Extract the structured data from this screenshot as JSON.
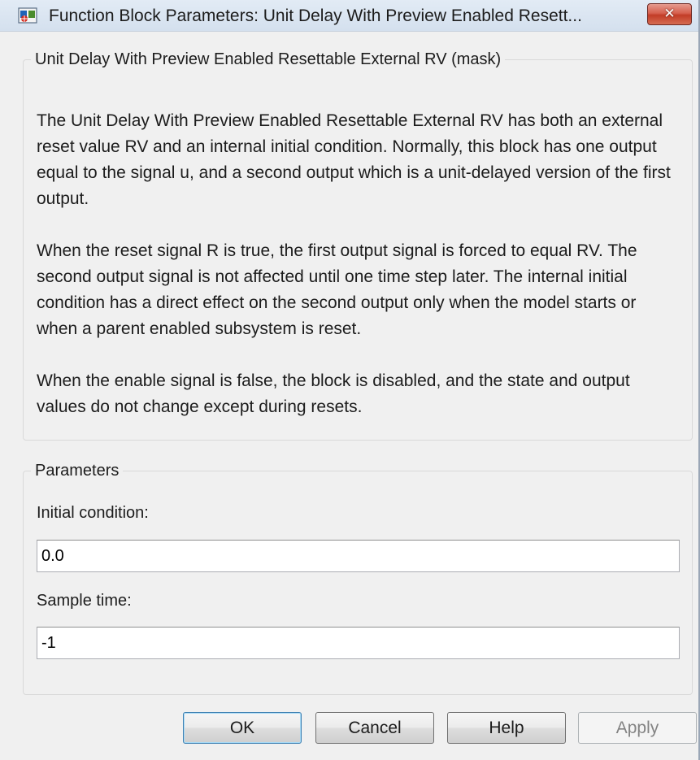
{
  "window": {
    "title": "Function Block Parameters: Unit Delay With Preview Enabled Resett...",
    "app_icon": "simulink-block-icon",
    "close_icon": "close-icon",
    "close_label": "✕"
  },
  "description": {
    "group_title": "Unit Delay With Preview Enabled Resettable External RV (mask)",
    "paragraphs": [
      "The Unit Delay With Preview Enabled Resettable External RV has both an external reset value RV and an internal initial condition. Normally, this block has one output equal to the signal u, and a second output which is a unit-delayed version of the first output.",
      "When the reset signal R is true, the first output signal is forced to equal RV. The second output signal is not affected until one time step later. The internal initial condition has a direct effect on the second output only when the model starts or when a parent enabled subsystem is reset.",
      "When the enable signal is false, the block is disabled, and the state and output values do not change except during resets."
    ]
  },
  "parameters": {
    "group_title": "Parameters",
    "initial_condition": {
      "label": "Initial condition:",
      "value": "0.0"
    },
    "sample_time": {
      "label": "Sample time:",
      "value": "-1"
    }
  },
  "buttons": {
    "ok": "OK",
    "cancel": "Cancel",
    "help": "Help",
    "apply": "Apply"
  },
  "colors": {
    "close_button": "#c23d27",
    "default_button_border": "#3c7fb1",
    "disabled_text": "#838383"
  }
}
